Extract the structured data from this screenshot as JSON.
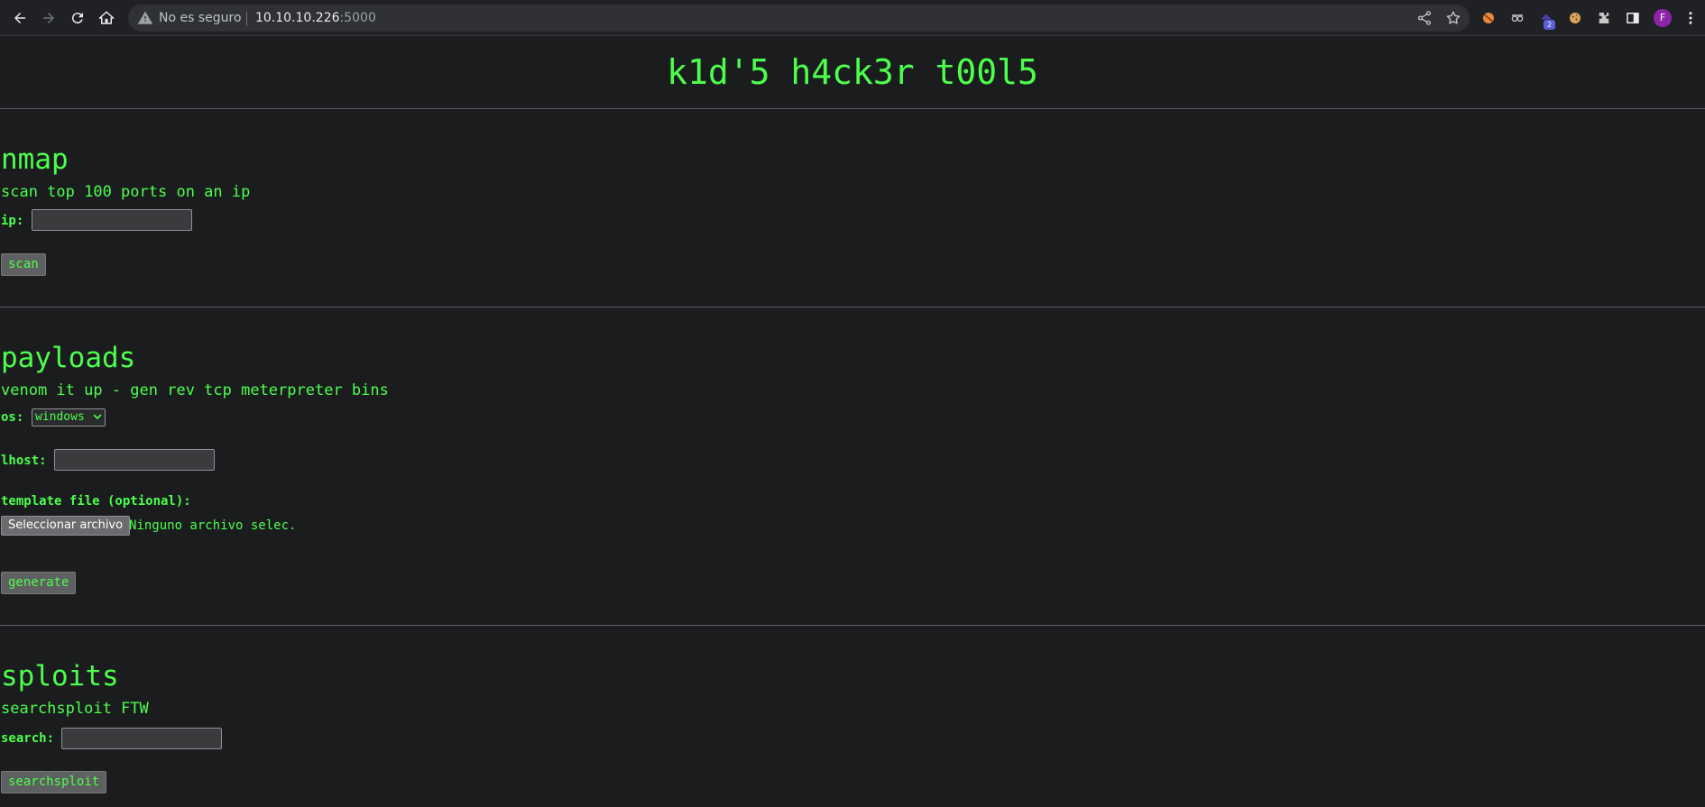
{
  "browser": {
    "security_label": "No es seguro",
    "url_host": "10.10.10.226",
    "url_port": ":5000",
    "extension_badge": "2",
    "profile_initial": "F"
  },
  "page": {
    "title": "k1d'5 h4ck3r t00l5"
  },
  "nmap": {
    "heading": "nmap",
    "description": "scan top 100 ports on an ip",
    "ip_label": "ip:",
    "ip_value": "",
    "scan_label": "scan"
  },
  "payloads": {
    "heading": "payloads",
    "description": "venom it up - gen rev tcp meterpreter bins",
    "os_label": "os:",
    "os_selected": "windows",
    "lhost_label": "lhost:",
    "lhost_value": "",
    "template_label": "template file (optional):",
    "file_button_label": "Seleccionar archivo",
    "file_status": "Ninguno archivo selec.",
    "generate_label": "generate"
  },
  "sploits": {
    "heading": "sploits",
    "description": "searchsploit FTW",
    "search_label": "search:",
    "search_value": "",
    "searchsploit_label": "searchsploit"
  },
  "colors": {
    "background": "#1b1c1e",
    "accent_green": "#4cff4c",
    "button_gray": "#5f6061"
  }
}
